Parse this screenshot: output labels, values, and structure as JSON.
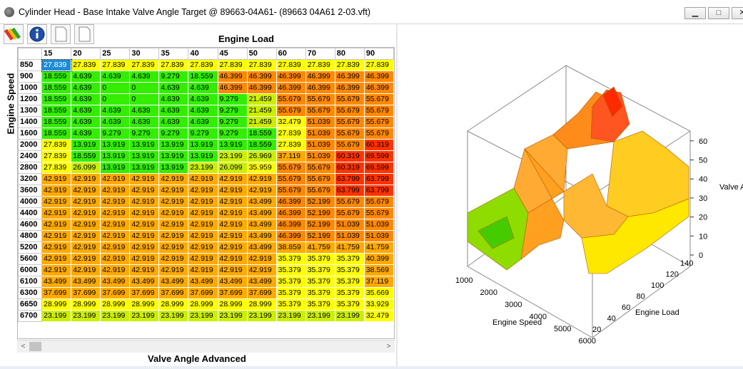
{
  "window": {
    "title": "Cylinder Head - Base Intake Valve Angle Target @ 89663-04A61- (89663 04A61 2-03.vft)",
    "controls": {
      "minimize": "▁",
      "maximize": "□",
      "close": "✕"
    }
  },
  "toolbar": {
    "icons": [
      "palette-icon",
      "info-icon",
      "blank-page-icon",
      "blank-page-icon"
    ]
  },
  "axes": {
    "load_label": "Engine Load",
    "speed_label": "Engine Speed",
    "bottom_label": "Valve Angle Advanced"
  },
  "table": {
    "columns": [
      "15",
      "20",
      "25",
      "30",
      "35",
      "40",
      "45",
      "50",
      "60",
      "70",
      "80",
      "90"
    ],
    "rows": [
      {
        "rpm": "850",
        "values": [
          "27.839",
          "27.839",
          "27.839",
          "27.839",
          "27.839",
          "27.839",
          "27.839",
          "27.839",
          "27.839",
          "27.839",
          "27.839",
          "27.839"
        ]
      },
      {
        "rpm": "900",
        "values": [
          "18.559",
          "4.639",
          "4.639",
          "4.639",
          "9.279",
          "18.559",
          "46.399",
          "46.399",
          "46.399",
          "46.399",
          "46.399",
          "46.399"
        ]
      },
      {
        "rpm": "1000",
        "values": [
          "18.559",
          "4.639",
          "0",
          "0",
          "4.639",
          "4.639",
          "46.399",
          "46.399",
          "46.399",
          "46.399",
          "46.399",
          "46.399"
        ]
      },
      {
        "rpm": "1200",
        "values": [
          "18.559",
          "4.639",
          "0",
          "0",
          "4.639",
          "4.639",
          "9.279",
          "21.459",
          "55.679",
          "55.679",
          "55.679",
          "55.679"
        ]
      },
      {
        "rpm": "1300",
        "values": [
          "18.559",
          "4.639",
          "4.639",
          "4.639",
          "4.639",
          "4.639",
          "9.279",
          "21.459",
          "55.679",
          "55.679",
          "55.679",
          "55.679"
        ]
      },
      {
        "rpm": "1400",
        "values": [
          "18.559",
          "4.639",
          "4.639",
          "4.639",
          "4.639",
          "4.639",
          "9.279",
          "21.459",
          "32.479",
          "51.039",
          "55.679",
          "55.679"
        ]
      },
      {
        "rpm": "1600",
        "values": [
          "18.559",
          "4.639",
          "9.279",
          "9.279",
          "9.279",
          "9.279",
          "9.279",
          "18.559",
          "27.839",
          "51.039",
          "55.679",
          "55.679"
        ]
      },
      {
        "rpm": "2000",
        "values": [
          "27.839",
          "13.919",
          "13.919",
          "13.919",
          "13.919",
          "13.919",
          "13.919",
          "18.559",
          "27.839",
          "51.039",
          "55.679",
          "60.319"
        ]
      },
      {
        "rpm": "2400",
        "values": [
          "27.839",
          "18.559",
          "13.919",
          "13.919",
          "13.919",
          "13.919",
          "23.199",
          "26.969",
          "37.119",
          "51.039",
          "60.319",
          "69.599"
        ]
      },
      {
        "rpm": "2800",
        "values": [
          "27.839",
          "26.099",
          "13.919",
          "13.919",
          "13.919",
          "23.199",
          "26.099",
          "35.959",
          "55.679",
          "55.679",
          "60.319",
          "69.599"
        ]
      },
      {
        "rpm": "3200",
        "values": [
          "42.919",
          "42.919",
          "42.919",
          "42.919",
          "42.919",
          "42.919",
          "42.919",
          "42.919",
          "55.679",
          "55.679",
          "63.799",
          "63.799"
        ]
      },
      {
        "rpm": "3600",
        "values": [
          "42.919",
          "42.919",
          "42.919",
          "42.919",
          "42.919",
          "42.919",
          "42.919",
          "42.919",
          "55.679",
          "55.679",
          "63.799",
          "63.799"
        ]
      },
      {
        "rpm": "4000",
        "values": [
          "42.919",
          "42.919",
          "42.919",
          "42.919",
          "42.919",
          "42.919",
          "42.919",
          "43.499",
          "46.399",
          "52.199",
          "55.679",
          "55.679"
        ]
      },
      {
        "rpm": "4400",
        "values": [
          "42.919",
          "42.919",
          "42.919",
          "42.919",
          "42.919",
          "42.919",
          "42.919",
          "43.499",
          "46.399",
          "52.199",
          "55.679",
          "55.679"
        ]
      },
      {
        "rpm": "4600",
        "values": [
          "42.919",
          "42.919",
          "42.919",
          "42.919",
          "42.919",
          "42.919",
          "42.919",
          "43.499",
          "46.399",
          "52.199",
          "51.039",
          "51.039"
        ]
      },
      {
        "rpm": "4800",
        "values": [
          "42.919",
          "42.919",
          "42.919",
          "42.919",
          "42.919",
          "42.919",
          "42.919",
          "43.499",
          "46.399",
          "52.199",
          "51.039",
          "51.039"
        ]
      },
      {
        "rpm": "5200",
        "values": [
          "42.919",
          "42.919",
          "42.919",
          "42.919",
          "42.919",
          "42.919",
          "42.919",
          "43.499",
          "38.859",
          "41.759",
          "41.759",
          "41.759"
        ]
      },
      {
        "rpm": "5600",
        "values": [
          "42.919",
          "42.919",
          "42.919",
          "42.919",
          "42.919",
          "42.919",
          "42.919",
          "42.919",
          "35.379",
          "35.379",
          "35.379",
          "40.399"
        ]
      },
      {
        "rpm": "6000",
        "values": [
          "42.919",
          "42.919",
          "42.919",
          "42.919",
          "42.919",
          "42.919",
          "42.919",
          "42.919",
          "35.379",
          "35.379",
          "35.379",
          "38.569"
        ]
      },
      {
        "rpm": "6100",
        "values": [
          "43.499",
          "43.499",
          "43.499",
          "43.499",
          "43.499",
          "43.499",
          "43.499",
          "43.499",
          "35.379",
          "35.379",
          "35.379",
          "37.119"
        ]
      },
      {
        "rpm": "6300",
        "values": [
          "37.699",
          "37.699",
          "37.699",
          "37.699",
          "37.699",
          "37.699",
          "37.699",
          "37.699",
          "35.379",
          "35.379",
          "35.379",
          "35.669"
        ]
      },
      {
        "rpm": "6650",
        "values": [
          "28.999",
          "28.999",
          "28.999",
          "28.999",
          "28.999",
          "28.999",
          "28.999",
          "28.999",
          "35.379",
          "35.379",
          "35.379",
          "33.929"
        ]
      },
      {
        "rpm": "6700",
        "values": [
          "23.199",
          "23.199",
          "23.199",
          "23.199",
          "23.199",
          "23.199",
          "23.199",
          "23.199",
          "23.199",
          "23.199",
          "23.199",
          "32.479"
        ]
      }
    ],
    "selected": {
      "row": 0,
      "col": 0
    }
  },
  "scrollbar": {
    "left_arrow": "<",
    "right_arrow": ">"
  },
  "chart3d": {
    "z_ticks": [
      "0",
      "10",
      "20",
      "30",
      "40",
      "50",
      "60"
    ],
    "z_label": "Valve A",
    "speed_ticks": [
      "1000",
      "2000",
      "3000",
      "4000",
      "5000",
      "6000"
    ],
    "speed_label": "Engine Speed",
    "load_ticks": [
      "20",
      "40",
      "60",
      "80",
      "100",
      "120",
      "140"
    ],
    "load_label": "Engine Load"
  },
  "colors": {
    "green": "#33ee00",
    "lime": "#ccee00",
    "yellow": "#ffff00",
    "amber": "#ffaa00",
    "orange": "#ff8800",
    "red": "#ff3300",
    "selected": "#1d8bd8"
  }
}
